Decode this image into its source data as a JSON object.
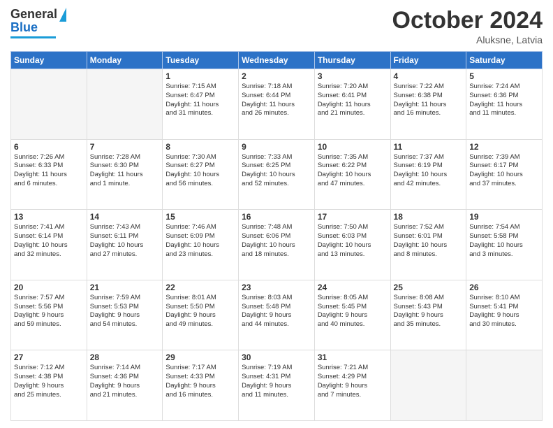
{
  "header": {
    "logo_general": "General",
    "logo_blue": "Blue",
    "month_title": "October 2024",
    "location": "Aluksne, Latvia"
  },
  "weekdays": [
    "Sunday",
    "Monday",
    "Tuesday",
    "Wednesday",
    "Thursday",
    "Friday",
    "Saturday"
  ],
  "weeks": [
    [
      {
        "day": "",
        "content": ""
      },
      {
        "day": "",
        "content": ""
      },
      {
        "day": "1",
        "content": "Sunrise: 7:15 AM\nSunset: 6:47 PM\nDaylight: 11 hours\nand 31 minutes."
      },
      {
        "day": "2",
        "content": "Sunrise: 7:18 AM\nSunset: 6:44 PM\nDaylight: 11 hours\nand 26 minutes."
      },
      {
        "day": "3",
        "content": "Sunrise: 7:20 AM\nSunset: 6:41 PM\nDaylight: 11 hours\nand 21 minutes."
      },
      {
        "day": "4",
        "content": "Sunrise: 7:22 AM\nSunset: 6:38 PM\nDaylight: 11 hours\nand 16 minutes."
      },
      {
        "day": "5",
        "content": "Sunrise: 7:24 AM\nSunset: 6:36 PM\nDaylight: 11 hours\nand 11 minutes."
      }
    ],
    [
      {
        "day": "6",
        "content": "Sunrise: 7:26 AM\nSunset: 6:33 PM\nDaylight: 11 hours\nand 6 minutes."
      },
      {
        "day": "7",
        "content": "Sunrise: 7:28 AM\nSunset: 6:30 PM\nDaylight: 11 hours\nand 1 minute."
      },
      {
        "day": "8",
        "content": "Sunrise: 7:30 AM\nSunset: 6:27 PM\nDaylight: 10 hours\nand 56 minutes."
      },
      {
        "day": "9",
        "content": "Sunrise: 7:33 AM\nSunset: 6:25 PM\nDaylight: 10 hours\nand 52 minutes."
      },
      {
        "day": "10",
        "content": "Sunrise: 7:35 AM\nSunset: 6:22 PM\nDaylight: 10 hours\nand 47 minutes."
      },
      {
        "day": "11",
        "content": "Sunrise: 7:37 AM\nSunset: 6:19 PM\nDaylight: 10 hours\nand 42 minutes."
      },
      {
        "day": "12",
        "content": "Sunrise: 7:39 AM\nSunset: 6:17 PM\nDaylight: 10 hours\nand 37 minutes."
      }
    ],
    [
      {
        "day": "13",
        "content": "Sunrise: 7:41 AM\nSunset: 6:14 PM\nDaylight: 10 hours\nand 32 minutes."
      },
      {
        "day": "14",
        "content": "Sunrise: 7:43 AM\nSunset: 6:11 PM\nDaylight: 10 hours\nand 27 minutes."
      },
      {
        "day": "15",
        "content": "Sunrise: 7:46 AM\nSunset: 6:09 PM\nDaylight: 10 hours\nand 23 minutes."
      },
      {
        "day": "16",
        "content": "Sunrise: 7:48 AM\nSunset: 6:06 PM\nDaylight: 10 hours\nand 18 minutes."
      },
      {
        "day": "17",
        "content": "Sunrise: 7:50 AM\nSunset: 6:03 PM\nDaylight: 10 hours\nand 13 minutes."
      },
      {
        "day": "18",
        "content": "Sunrise: 7:52 AM\nSunset: 6:01 PM\nDaylight: 10 hours\nand 8 minutes."
      },
      {
        "day": "19",
        "content": "Sunrise: 7:54 AM\nSunset: 5:58 PM\nDaylight: 10 hours\nand 3 minutes."
      }
    ],
    [
      {
        "day": "20",
        "content": "Sunrise: 7:57 AM\nSunset: 5:56 PM\nDaylight: 9 hours\nand 59 minutes."
      },
      {
        "day": "21",
        "content": "Sunrise: 7:59 AM\nSunset: 5:53 PM\nDaylight: 9 hours\nand 54 minutes."
      },
      {
        "day": "22",
        "content": "Sunrise: 8:01 AM\nSunset: 5:50 PM\nDaylight: 9 hours\nand 49 minutes."
      },
      {
        "day": "23",
        "content": "Sunrise: 8:03 AM\nSunset: 5:48 PM\nDaylight: 9 hours\nand 44 minutes."
      },
      {
        "day": "24",
        "content": "Sunrise: 8:05 AM\nSunset: 5:45 PM\nDaylight: 9 hours\nand 40 minutes."
      },
      {
        "day": "25",
        "content": "Sunrise: 8:08 AM\nSunset: 5:43 PM\nDaylight: 9 hours\nand 35 minutes."
      },
      {
        "day": "26",
        "content": "Sunrise: 8:10 AM\nSunset: 5:41 PM\nDaylight: 9 hours\nand 30 minutes."
      }
    ],
    [
      {
        "day": "27",
        "content": "Sunrise: 7:12 AM\nSunset: 4:38 PM\nDaylight: 9 hours\nand 25 minutes."
      },
      {
        "day": "28",
        "content": "Sunrise: 7:14 AM\nSunset: 4:36 PM\nDaylight: 9 hours\nand 21 minutes."
      },
      {
        "day": "29",
        "content": "Sunrise: 7:17 AM\nSunset: 4:33 PM\nDaylight: 9 hours\nand 16 minutes."
      },
      {
        "day": "30",
        "content": "Sunrise: 7:19 AM\nSunset: 4:31 PM\nDaylight: 9 hours\nand 11 minutes."
      },
      {
        "day": "31",
        "content": "Sunrise: 7:21 AM\nSunset: 4:29 PM\nDaylight: 9 hours\nand 7 minutes."
      },
      {
        "day": "",
        "content": ""
      },
      {
        "day": "",
        "content": ""
      }
    ]
  ]
}
